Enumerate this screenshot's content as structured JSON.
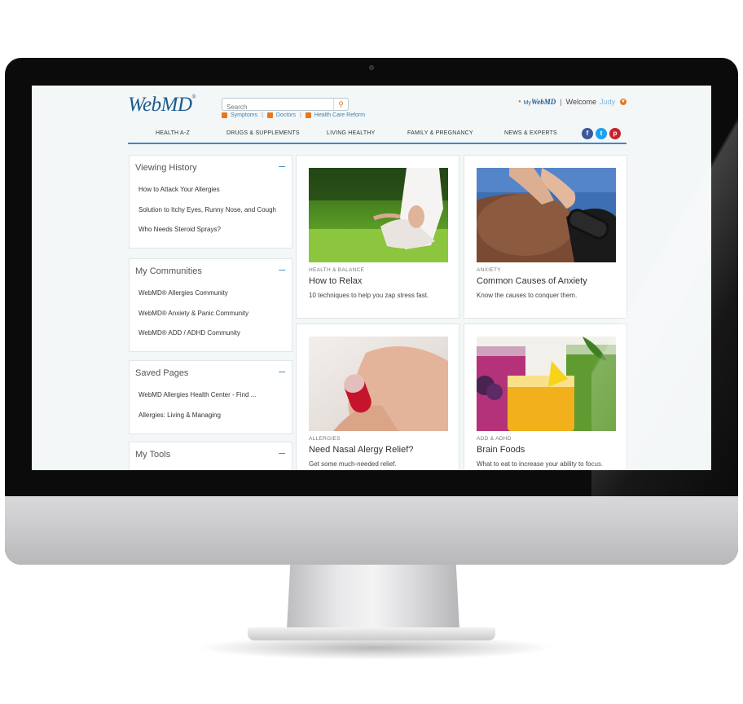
{
  "header": {
    "logo_text": "WebMD",
    "search_placeholder": "Search",
    "quick_links": [
      "Symptoms",
      "Doctors",
      "Health Care Reform"
    ]
  },
  "account": {
    "my_webmd_prefix": "My",
    "my_webmd_brand": "WebMD",
    "separator": "|",
    "welcome": "Welcome",
    "user": "Judy"
  },
  "nav": {
    "items": [
      "HEALTH A-Z",
      "DRUGS & SUPPLEMENTS",
      "LIVING HEALTHY",
      "FAMILY & PREGNANCY",
      "NEWS & EXPERTS"
    ]
  },
  "social": {
    "facebook": "f",
    "twitter": "t",
    "pinterest": "p"
  },
  "sidebar": {
    "viewing_history": {
      "title": "Viewing History",
      "links": [
        "How to Attack Your Allergies",
        "Solution to Itchy Eyes, Runny Nose, and Cough",
        "Who Needs Steroid Sprays?"
      ]
    },
    "communities": {
      "title": "My Communities",
      "links": [
        "WebMD® Allergies Community",
        "WebMD® Anxiety & Panic Community",
        "WebMD® ADD / ADHD Community"
      ]
    },
    "saved_pages": {
      "title": "Saved Pages",
      "links": [
        "WebMD Allergies Health Center - Find ...",
        "Allergies: Living & Managing"
      ]
    },
    "tools": {
      "title": "My Tools"
    },
    "collapse_symbol": "–"
  },
  "cards": [
    {
      "category": "HEALTH & BALANCE",
      "title": "How to Relax",
      "description": "10 techniques to help you zap stress fast."
    },
    {
      "category": "ANXIETY",
      "title": "Common Causes of Anxiety",
      "description": "Know the causes to conquer them."
    },
    {
      "category": "ALLERGIES",
      "title": "Need Nasal Alergy Relief?",
      "description": "Get some much-needed relief."
    },
    {
      "category": "ADD & ADHD",
      "title": "Brain Foods",
      "description": "What to eat to increase your ability to focus."
    }
  ],
  "colors": {
    "brand_blue": "#1b5b8e",
    "accent_orange": "#e8781a",
    "nav_underline": "#3a89c9",
    "screen_bg": "#f4f7f8"
  }
}
